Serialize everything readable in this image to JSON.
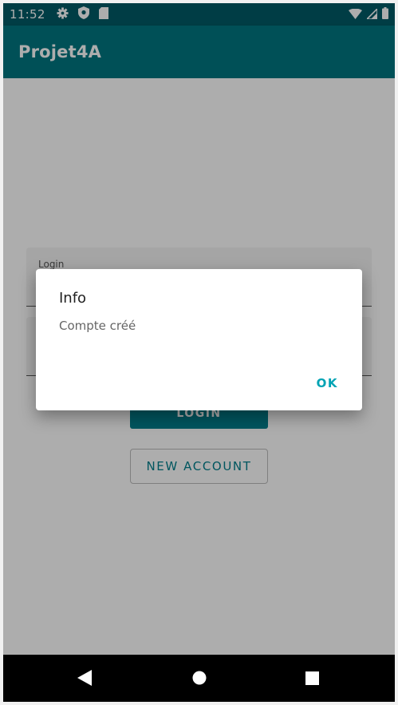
{
  "status_bar": {
    "time": "11:52",
    "icons": [
      "gear-icon",
      "shield-icon",
      "sd-card-icon",
      "wifi-icon",
      "signal-icon",
      "battery-icon"
    ]
  },
  "app_bar": {
    "title": "Projet4A"
  },
  "form": {
    "login_label": "Login",
    "login_button": "LOGIN",
    "new_account_button": "NEW ACCOUNT"
  },
  "dialog": {
    "title": "Info",
    "message": "Compte créé",
    "ok_label": "OK"
  },
  "nav_bar": {
    "icons": [
      "back-icon",
      "home-icon",
      "recents-icon"
    ]
  },
  "colors": {
    "status_bar": "#005b66",
    "app_bar": "#007681",
    "accent": "#007f8c",
    "dialog_button": "#00a3b4"
  }
}
